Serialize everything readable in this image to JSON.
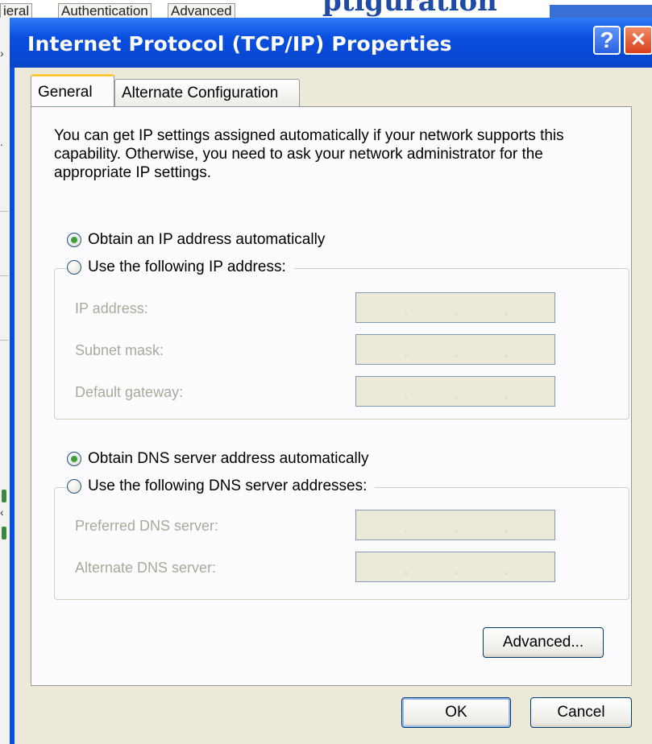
{
  "background": {
    "tabs": [
      "ieral",
      "Authentication",
      "Advanced"
    ],
    "heading_fragment": "ptiguration",
    "left_strip_fragments": [
      "›",
      ".",
      "‹"
    ]
  },
  "dialog": {
    "title": "Internet Protocol (TCP/IP) Properties",
    "help_glyph": "?",
    "close_glyph": "✕",
    "tabs": [
      {
        "label": "General",
        "selected": true
      },
      {
        "label": "Alternate Configuration",
        "selected": false
      }
    ],
    "description": "You can get IP settings assigned automatically if your network supports this capability. Otherwise, you need to ask your network administrator for the appropriate IP settings.",
    "ip_options": {
      "auto_label": "Obtain an IP address automatically",
      "auto_selected": true,
      "manual_label": "Use the following IP address:",
      "manual_selected": false,
      "fields": [
        {
          "label": "IP address:",
          "value": ""
        },
        {
          "label": "Subnet mask:",
          "value": ""
        },
        {
          "label": "Default gateway:",
          "value": ""
        }
      ]
    },
    "dns_options": {
      "auto_label": "Obtain DNS server address automatically",
      "auto_selected": true,
      "manual_label": "Use the following DNS server addresses:",
      "manual_selected": false,
      "fields": [
        {
          "label": "Preferred DNS server:",
          "value": ""
        },
        {
          "label": "Alternate DNS server:",
          "value": ""
        }
      ]
    },
    "buttons": {
      "advanced": "Advanced...",
      "ok": "OK",
      "cancel": "Cancel"
    },
    "colors": {
      "titlebar": "#0a4ee0",
      "client": "#ece9d8",
      "disabled_text": "#aca899",
      "radio_dot": "#3ca13c"
    }
  }
}
